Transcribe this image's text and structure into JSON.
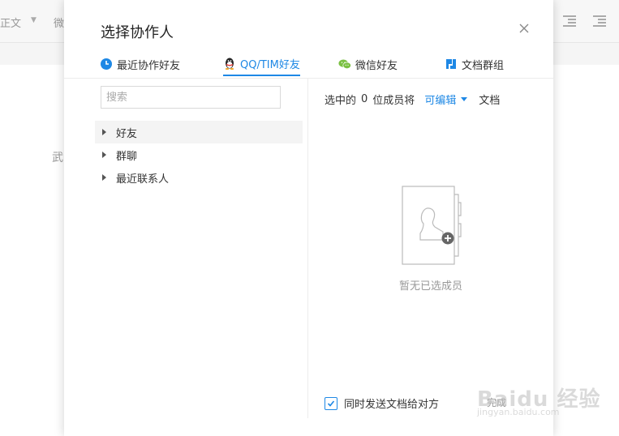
{
  "background": {
    "style_label": "正文",
    "font_label": "微",
    "doc_text": "武"
  },
  "dialog": {
    "title": "选择协作人",
    "tabs": [
      {
        "label": "最近协作好友",
        "icon": "clock-icon"
      },
      {
        "label": "QQ/TIM好友",
        "icon": "qq-penguin-icon",
        "active": true
      },
      {
        "label": "微信好友",
        "icon": "wechat-icon"
      },
      {
        "label": "文档群组",
        "icon": "doc-group-icon"
      }
    ],
    "search": {
      "placeholder": "搜索",
      "value": ""
    },
    "tree": [
      {
        "label": "好友"
      },
      {
        "label": "群聊"
      },
      {
        "label": "最近联系人"
      }
    ],
    "selection": {
      "prefix": "选中的",
      "count": "0",
      "suffix": "位成员将",
      "permission": "可编辑",
      "object": "文档"
    },
    "empty_text": "暂无已选成员",
    "send_doc_label": "同时发送文档给对方",
    "send_doc_checked": true,
    "done_label": "完成"
  },
  "watermark": {
    "main": "Baidu 经验",
    "sub": "jingyan.baidu.com"
  },
  "colors": {
    "accent": "#1e88e5",
    "muted": "#999999"
  }
}
